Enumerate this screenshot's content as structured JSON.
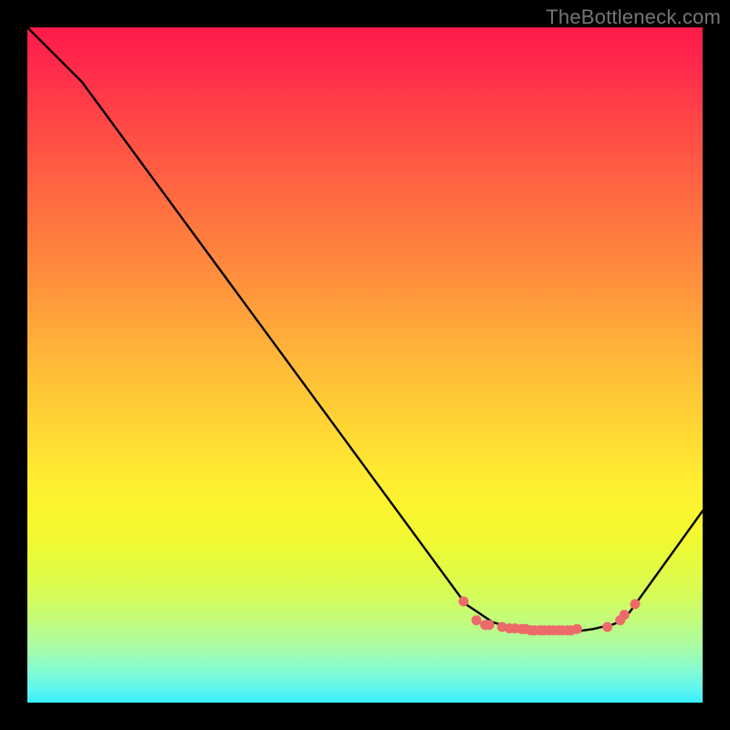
{
  "watermark": "TheBottleneck.com",
  "colors": {
    "frame": "#000000",
    "watermark_text": "#757575",
    "curve": "#000000",
    "dot": "#ed6a6a"
  },
  "chart_data": {
    "type": "line",
    "title": "",
    "xlabel": "",
    "ylabel": "",
    "xlim": [
      0,
      100
    ],
    "ylim": [
      0,
      100
    ],
    "curve_points_pct": [
      [
        0.0,
        100.0
      ],
      [
        8.1,
        91.9
      ],
      [
        64.9,
        14.6
      ],
      [
        68.9,
        11.9
      ],
      [
        70.3,
        11.5
      ],
      [
        71.6,
        11.2
      ],
      [
        73.0,
        10.9
      ],
      [
        74.3,
        10.7
      ],
      [
        75.7,
        10.5
      ],
      [
        77.0,
        10.4
      ],
      [
        78.4,
        10.4
      ],
      [
        79.7,
        10.4
      ],
      [
        81.1,
        10.5
      ],
      [
        82.4,
        10.7
      ],
      [
        83.8,
        10.9
      ],
      [
        85.1,
        11.2
      ],
      [
        86.5,
        11.5
      ],
      [
        87.8,
        12.0
      ],
      [
        89.2,
        13.4
      ],
      [
        100.0,
        28.4
      ]
    ],
    "highlight_dots_pct": [
      [
        64.6,
        15.0
      ],
      [
        66.5,
        12.2
      ],
      [
        67.8,
        11.5
      ],
      [
        68.4,
        11.5
      ],
      [
        70.3,
        11.2
      ],
      [
        71.4,
        11.0
      ],
      [
        72.2,
        11.0
      ],
      [
        73.2,
        10.9
      ],
      [
        73.8,
        10.9
      ],
      [
        74.6,
        10.7
      ],
      [
        75.1,
        10.7
      ],
      [
        75.9,
        10.7
      ],
      [
        76.5,
        10.7
      ],
      [
        77.3,
        10.7
      ],
      [
        77.8,
        10.7
      ],
      [
        78.6,
        10.7
      ],
      [
        79.2,
        10.7
      ],
      [
        80.0,
        10.7
      ],
      [
        80.5,
        10.7
      ],
      [
        81.4,
        10.9
      ],
      [
        85.9,
        11.2
      ],
      [
        87.8,
        12.2
      ],
      [
        88.4,
        13.0
      ],
      [
        90.0,
        14.6
      ]
    ]
  }
}
